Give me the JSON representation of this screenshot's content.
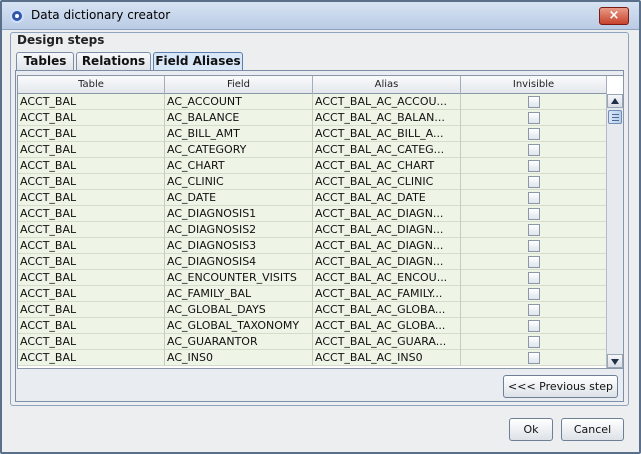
{
  "window": {
    "title": "Data dictionary creator",
    "close_label": "×"
  },
  "group": {
    "title": "Design steps"
  },
  "tabs": [
    {
      "label": "Tables",
      "active": false
    },
    {
      "label": "Relations",
      "active": false
    },
    {
      "label": "Field Aliases",
      "active": true
    }
  ],
  "table": {
    "columns": [
      "Table",
      "Field",
      "Alias",
      "Invisible"
    ],
    "rows": [
      {
        "table": "ACCT_BAL",
        "field": "AC_ACCOUNT",
        "alias": "ACCT_BAL_AC_ACCOU...",
        "invisible": false
      },
      {
        "table": "ACCT_BAL",
        "field": "AC_BALANCE",
        "alias": "ACCT_BAL_AC_BALAN...",
        "invisible": false
      },
      {
        "table": "ACCT_BAL",
        "field": "AC_BILL_AMT",
        "alias": "ACCT_BAL_AC_BILL_A...",
        "invisible": false
      },
      {
        "table": "ACCT_BAL",
        "field": "AC_CATEGORY",
        "alias": "ACCT_BAL_AC_CATEG...",
        "invisible": false
      },
      {
        "table": "ACCT_BAL",
        "field": "AC_CHART",
        "alias": "ACCT_BAL_AC_CHART",
        "invisible": false
      },
      {
        "table": "ACCT_BAL",
        "field": "AC_CLINIC",
        "alias": "ACCT_BAL_AC_CLINIC",
        "invisible": false
      },
      {
        "table": "ACCT_BAL",
        "field": "AC_DATE",
        "alias": "ACCT_BAL_AC_DATE",
        "invisible": false
      },
      {
        "table": "ACCT_BAL",
        "field": "AC_DIAGNOSIS1",
        "alias": "ACCT_BAL_AC_DIAGN...",
        "invisible": false
      },
      {
        "table": "ACCT_BAL",
        "field": "AC_DIAGNOSIS2",
        "alias": "ACCT_BAL_AC_DIAGN...",
        "invisible": false
      },
      {
        "table": "ACCT_BAL",
        "field": "AC_DIAGNOSIS3",
        "alias": "ACCT_BAL_AC_DIAGN...",
        "invisible": false
      },
      {
        "table": "ACCT_BAL",
        "field": "AC_DIAGNOSIS4",
        "alias": "ACCT_BAL_AC_DIAGN...",
        "invisible": false
      },
      {
        "table": "ACCT_BAL",
        "field": "AC_ENCOUNTER_VISITS",
        "alias": "ACCT_BAL_AC_ENCOU...",
        "invisible": false
      },
      {
        "table": "ACCT_BAL",
        "field": "AC_FAMILY_BAL",
        "alias": "ACCT_BAL_AC_FAMILY...",
        "invisible": false
      },
      {
        "table": "ACCT_BAL",
        "field": "AC_GLOBAL_DAYS",
        "alias": "ACCT_BAL_AC_GLOBA...",
        "invisible": false
      },
      {
        "table": "ACCT_BAL",
        "field": "AC_GLOBAL_TAXONOMY",
        "alias": "ACCT_BAL_AC_GLOBA...",
        "invisible": false
      },
      {
        "table": "ACCT_BAL",
        "field": "AC_GUARANTOR",
        "alias": "ACCT_BAL_AC_GUARA...",
        "invisible": false
      },
      {
        "table": "ACCT_BAL",
        "field": "AC_INS0",
        "alias": "ACCT_BAL_AC_INS0",
        "invisible": false
      }
    ]
  },
  "buttons": {
    "previous_step": "<<< Previous step",
    "ok": "Ok",
    "cancel": "Cancel"
  }
}
